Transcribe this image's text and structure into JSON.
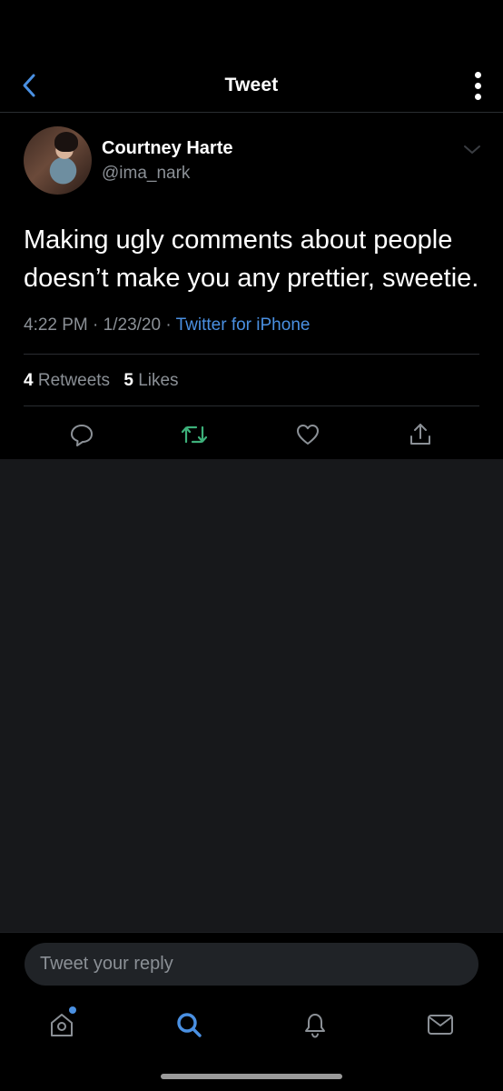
{
  "header": {
    "title": "Tweet",
    "back_icon": "chevron-left-icon",
    "more_icon": "vertical-ellipsis-icon"
  },
  "tweet": {
    "author_name": "Courtney Harte",
    "author_handle": "@ima_nark",
    "text": "Making ugly comments about people doesn’t make you any prettier, sweetie.",
    "time": "4:22 PM",
    "date": "1/23/20",
    "source": "Twitter for iPhone",
    "retweets_count": "4",
    "retweets_label": "Retweets",
    "likes_count": "5",
    "likes_label": "Likes"
  },
  "actions": {
    "reply_icon": "reply-icon",
    "retweet_icon": "retweet-icon",
    "like_icon": "heart-icon",
    "share_icon": "share-icon"
  },
  "reply": {
    "placeholder": "Tweet your reply"
  },
  "tabbar": {
    "items": [
      "home-icon",
      "search-icon",
      "notifications-icon",
      "messages-icon"
    ],
    "active": "search-icon"
  },
  "colors": {
    "accent": "#4a90e2",
    "retweet": "#3db07a",
    "muted": "#8b9096",
    "background": "#000000",
    "empty_area": "#17181b"
  }
}
